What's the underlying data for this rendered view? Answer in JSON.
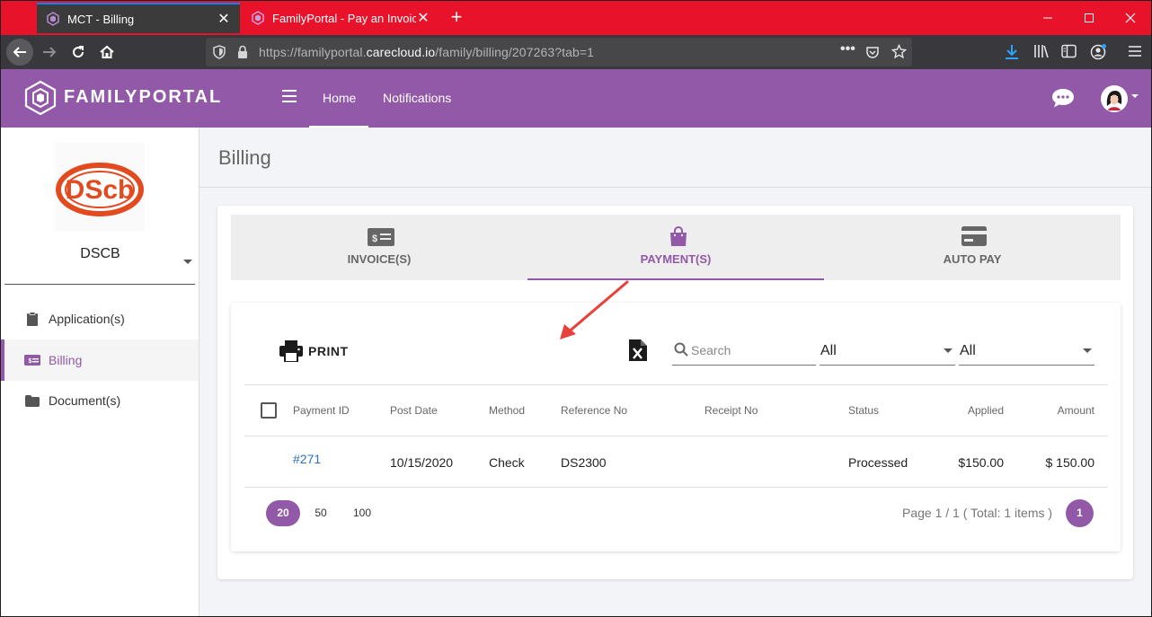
{
  "browser": {
    "tabs": [
      {
        "title": "MCT - Billing"
      },
      {
        "title": "FamilyPortal - Pay an Invoice –"
      }
    ],
    "url": {
      "scheme": "https://familyportal.",
      "domain": "carecloud.io",
      "path": "/family/billing/207263?tab=1"
    }
  },
  "app": {
    "brand": "FAMILYPORTAL",
    "nav": {
      "home": "Home",
      "notifications": "Notifications"
    }
  },
  "sidebar": {
    "org_name": "DSCB",
    "logo_text": "DScb",
    "items": [
      {
        "label": "Application(s)",
        "icon": "clipboard-icon"
      },
      {
        "label": "Billing",
        "icon": "invoice-icon"
      },
      {
        "label": "Document(s)",
        "icon": "folder-icon"
      }
    ]
  },
  "page": {
    "title": "Billing",
    "tabs": [
      {
        "label": "INVOICE(S)",
        "icon": "invoice-icon"
      },
      {
        "label": "PAYMENT(S)",
        "icon": "bag-icon"
      },
      {
        "label": "AUTO PAY",
        "icon": "credit-card-icon"
      }
    ],
    "active_tab": "PAYMENT(S)"
  },
  "toolbar": {
    "print_label": "PRINT",
    "search_placeholder": "Search",
    "filter1_value": "All",
    "filter2_value": "All"
  },
  "table": {
    "columns": [
      "Payment ID",
      "Post Date",
      "Method",
      "Reference No",
      "Receipt No",
      "Status",
      "Applied",
      "Amount"
    ],
    "rows": [
      {
        "payment_id": "#271",
        "post_date": "10/15/2020",
        "method": "Check",
        "reference_no": "DS2300",
        "receipt_no": "",
        "status": "Processed",
        "applied": "$150.00",
        "amount": "$ 150.00"
      }
    ]
  },
  "pagination": {
    "sizes": [
      "20",
      "50",
      "100"
    ],
    "active_size": "20",
    "info": "Page 1 / 1 ( Total: 1 items )",
    "current_page": "1"
  },
  "colors": {
    "brand_purple": "#9159a7",
    "browser_tabbar": "#e8132a",
    "link_blue": "#2a70c2",
    "annotation_arrow": "#e8403a"
  }
}
